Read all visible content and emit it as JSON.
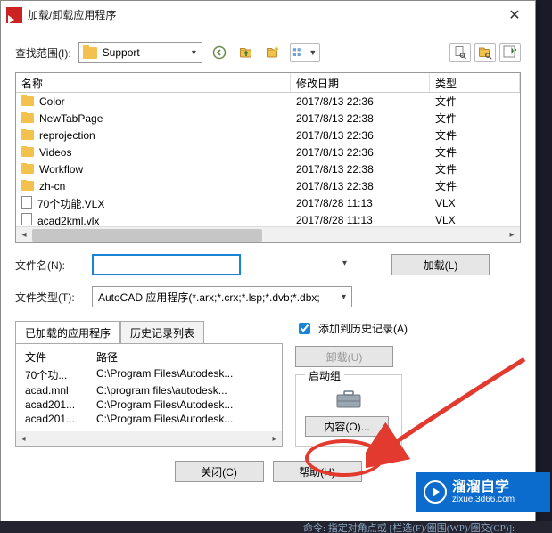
{
  "dialog": {
    "title": "加载/卸载应用程序",
    "lookin_label": "查找范围(I):",
    "lookin_folder": "Support",
    "file_table": {
      "columns": {
        "name": "名称",
        "date": "修改日期",
        "type": "类型"
      },
      "rows": [
        {
          "kind": "folder",
          "name": "Color",
          "date": "2017/8/13 22:36",
          "type": "文件"
        },
        {
          "kind": "folder",
          "name": "NewTabPage",
          "date": "2017/8/13 22:38",
          "type": "文件"
        },
        {
          "kind": "folder",
          "name": "reprojection",
          "date": "2017/8/13 22:36",
          "type": "文件"
        },
        {
          "kind": "folder",
          "name": "Videos",
          "date": "2017/8/13 22:36",
          "type": "文件"
        },
        {
          "kind": "folder",
          "name": "Workflow",
          "date": "2017/8/13 22:38",
          "type": "文件"
        },
        {
          "kind": "folder",
          "name": "zh-cn",
          "date": "2017/8/13 22:38",
          "type": "文件"
        },
        {
          "kind": "file",
          "name": "70个功能.VLX",
          "date": "2017/8/28 11:13",
          "type": "VLX"
        },
        {
          "kind": "file",
          "name": "acad2kml.vlx",
          "date": "2017/8/28 11:13",
          "type": "VLX"
        }
      ]
    },
    "filename_label": "文件名(N):",
    "filename_value": "",
    "filetype_label": "文件类型(T):",
    "filetype_value": "AutoCAD 应用程序(*.arx;*.crx;*.lsp;*.dvb;*.dbx;",
    "load_btn": "加载(L)",
    "loaded_tab": "已加载的应用程序",
    "history_tab": "历史记录列表",
    "loaded_cols": {
      "file": "文件",
      "path": "路径"
    },
    "loaded_rows": [
      {
        "file": "70个功...",
        "path": "C:\\Program Files\\Autodesk..."
      },
      {
        "file": "acad.mnl",
        "path": "C:\\program files\\autodesk..."
      },
      {
        "file": "acad201...",
        "path": "C:\\Program Files\\Autodesk..."
      },
      {
        "file": "acad201...",
        "path": "C:\\Program Files\\Autodesk..."
      }
    ],
    "add_history_chk": "添加到历史记录(A)",
    "unload_btn": "卸载(U)",
    "startup_legend": "启动组",
    "contents_btn": "内容(O)...",
    "close_btn": "关闭(C)",
    "help_btn": "帮助(H)"
  },
  "watermark": {
    "cn": "溜溜自学",
    "url": "zixue.3d66.com"
  },
  "bottom_hint": "命令: 指定对角点或 [栏选(F)/圈围(WP)/圈交(CP)]:"
}
